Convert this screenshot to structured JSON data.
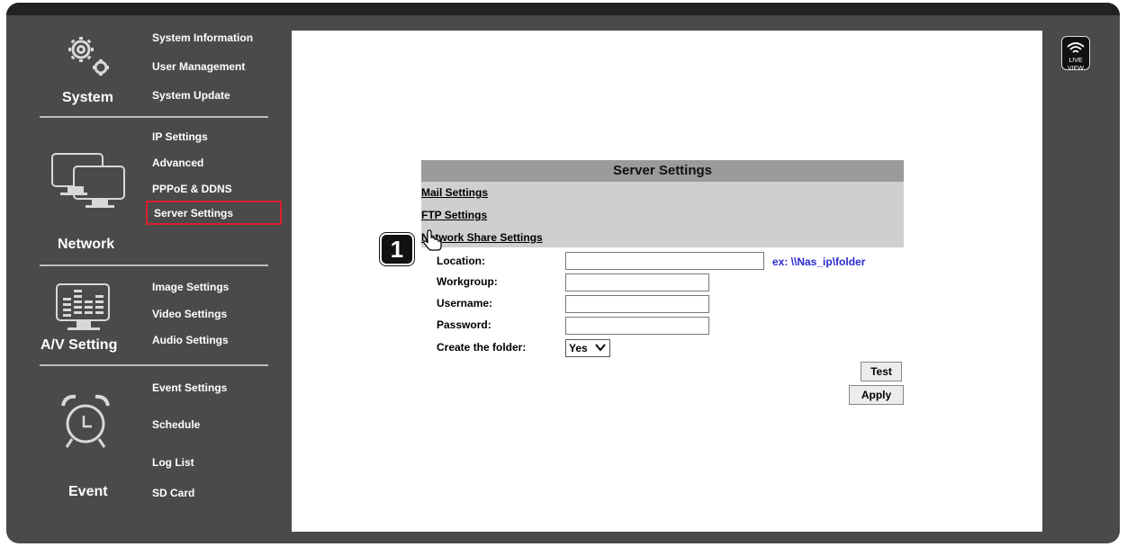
{
  "sidebar": {
    "system": {
      "label": "System",
      "icon": "gears-icon",
      "items": [
        "System Information",
        "User Management",
        "System Update"
      ]
    },
    "network": {
      "label": "Network",
      "icon": "monitors-icon",
      "items": [
        "IP Settings",
        "Advanced",
        "PPPoE & DDNS",
        "Server Settings"
      ]
    },
    "av": {
      "label": "A/V Setting",
      "icon": "av-monitor-icon",
      "items": [
        "Image Settings",
        "Video Settings",
        "Audio Settings"
      ]
    },
    "event": {
      "label": "Event",
      "icon": "alarm-clock-icon",
      "items": [
        "Event Settings",
        "Schedule",
        "Log List",
        "SD Card"
      ]
    },
    "active_item": "Server Settings",
    "active_color": "#d9202c"
  },
  "panel": {
    "title": "Server Settings",
    "links": [
      "Mail Settings",
      "FTP Settings",
      "Network Share Settings"
    ]
  },
  "form": {
    "location_label": "Location:",
    "location_value": "",
    "location_hint": "ex: \\\\Nas_ip\\folder",
    "workgroup_label": "Workgroup:",
    "workgroup_value": "",
    "username_label": "Username:",
    "username_value": "",
    "password_label": "Password:",
    "password_value": "",
    "create_folder_label": "Create the folder:",
    "create_folder_value": "Yes",
    "test_label": "Test",
    "apply_label": "Apply"
  },
  "annotation": {
    "step": "1"
  },
  "live_view": {
    "label": "LIVE VIEW",
    "icon": "wifi-icon"
  }
}
